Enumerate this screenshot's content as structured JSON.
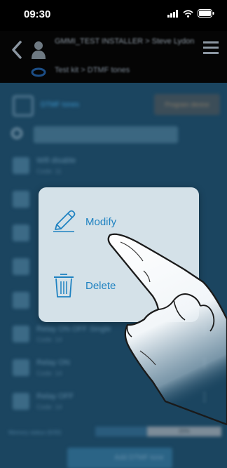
{
  "status_bar": {
    "time": "09:30"
  },
  "header": {
    "title": "GMMI_TEST INSTALLER > Steve Lydon",
    "subtitle": "Test kit > DTMF tones"
  },
  "toolbar": {
    "tab_label": "DTMF tones",
    "program_button": "Program device"
  },
  "list": [
    {
      "name": "Wifi disable",
      "code": "Code: 11"
    },
    {
      "name": "",
      "code": ""
    },
    {
      "name": "",
      "code": ""
    },
    {
      "name": "",
      "code": ""
    },
    {
      "name": "",
      "code": ""
    },
    {
      "name": "Relay ON OFF Single",
      "code": "Code: 14"
    },
    {
      "name": "Relay ON",
      "code": "Code: 14"
    },
    {
      "name": "Relay OFF",
      "code": "Code: 14"
    }
  ],
  "memory": {
    "label": "Memory status (6/30)",
    "used_fraction": 0.2,
    "value_text": "20%"
  },
  "add_button": "Add DTMF tone",
  "popup": {
    "modify_label": "Modify",
    "delete_label": "Delete"
  },
  "colors": {
    "accent": "#1f82c1",
    "popup_bg": "#d4e1e8",
    "screen_bg": "#1b4560"
  },
  "icons": [
    "back-chevron-icon",
    "user-icon",
    "hamburger-menu-icon",
    "calendar-icon",
    "search-icon",
    "pencil-icon",
    "trash-icon",
    "signal-icon",
    "wifi-icon",
    "battery-icon"
  ]
}
